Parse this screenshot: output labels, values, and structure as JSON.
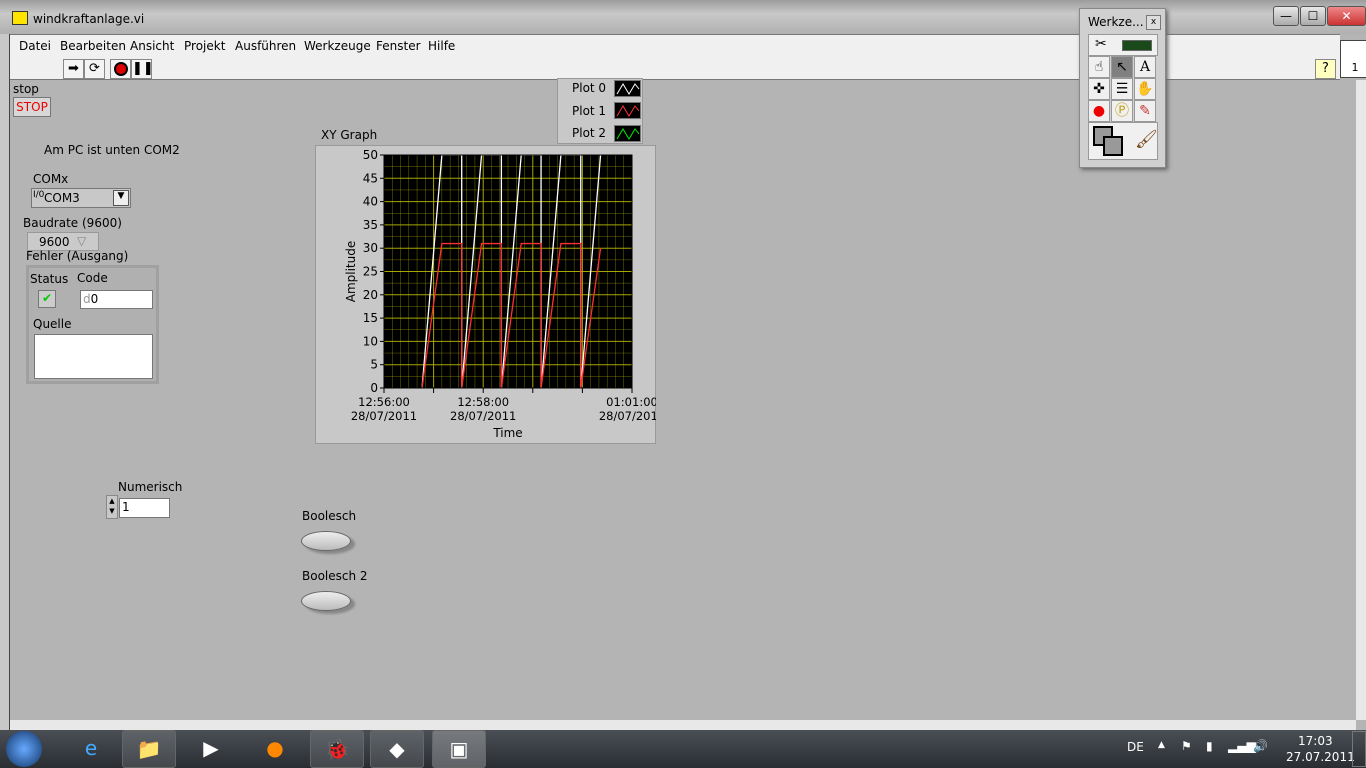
{
  "window": {
    "title": "windkraftanlage.vi",
    "controls": [
      "—",
      "☐",
      "✕"
    ]
  },
  "menu": [
    "Datei",
    "Bearbeiten",
    "Ansicht",
    "Projekt",
    "Ausführen",
    "Werkzeuge",
    "Fenster",
    "Hilfe"
  ],
  "toolbar": {
    "icons": [
      "run-arrow-icon",
      "run-continuously-icon",
      "abort-icon",
      "pause-icon"
    ],
    "help": "?",
    "connector_pane_number": "1"
  },
  "panel": {
    "stop_label": "stop",
    "stop_button": "STOP",
    "note": "Am PC ist unten COM2",
    "comx_label": "COMx",
    "comx_prefix": "I/0",
    "comx_value": "COM3",
    "baud_label": "Baudrate (9600)",
    "baud_value": "9600",
    "error_label": "Fehler (Ausgang)",
    "status_label": "Status",
    "code_label": "Code",
    "code_prefix": "d",
    "code_value": "0",
    "source_label": "Quelle",
    "source_value": "",
    "numeric_label": "Numerisch",
    "numeric_value": "1",
    "bool1_label": "Boolesch",
    "bool2_label": "Boolesch 2"
  },
  "palette": {
    "title": "Werkze...",
    "close": "x"
  },
  "chart_data": {
    "type": "line",
    "title": "XY Graph",
    "xlabel": "Time",
    "ylabel": "Amplitude",
    "xlim": [
      "12:56:00",
      "01:01:00"
    ],
    "ylim": [
      0,
      50
    ],
    "yticks": [
      0,
      5,
      10,
      15,
      20,
      25,
      30,
      35,
      40,
      45,
      50
    ],
    "xticks": [
      {
        "t": "12:56:00",
        "label1": "12:56:00",
        "label2": "28/07/2011"
      },
      {
        "t": "12:57:00",
        "label1": "",
        "label2": ""
      },
      {
        "t": "12:58:00",
        "label1": "12:58:00",
        "label2": "28/07/2011"
      },
      {
        "t": "12:59:00",
        "label1": "",
        "label2": ""
      },
      {
        "t": "01:00:00",
        "label1": "",
        "label2": ""
      },
      {
        "t": "01:01:00",
        "label1": "01:01:00",
        "label2": "28/07/2011"
      }
    ],
    "grid": true,
    "background": "#000000",
    "grid_color": "#b8b800",
    "legend_position": "top-right",
    "series": [
      {
        "name": "Plot 0",
        "color": "#ffffff",
        "points": [
          [
            "12:56:46",
            0
          ],
          [
            "12:57:10",
            50
          ],
          [
            "12:57:34",
            50
          ],
          [
            "12:57:34",
            0
          ],
          [
            "12:57:34",
            0
          ],
          [
            "12:57:58",
            50
          ],
          [
            "12:58:22",
            50
          ],
          [
            "12:58:22",
            0
          ],
          [
            "12:58:22",
            0
          ],
          [
            "12:58:46",
            50
          ],
          [
            "12:59:10",
            50
          ],
          [
            "12:59:10",
            0
          ],
          [
            "12:59:10",
            0
          ],
          [
            "12:59:34",
            50
          ],
          [
            "12:59:58",
            50
          ],
          [
            "12:59:58",
            0
          ],
          [
            "12:59:58",
            0
          ],
          [
            "01:00:22",
            50
          ]
        ]
      },
      {
        "name": "Plot 1",
        "color": "#ff3030",
        "points": [
          [
            "12:56:46",
            0
          ],
          [
            "12:57:10",
            31
          ],
          [
            "12:57:34",
            31
          ],
          [
            "12:57:34",
            0
          ],
          [
            "12:57:34",
            0
          ],
          [
            "12:57:58",
            31
          ],
          [
            "12:58:22",
            31
          ],
          [
            "12:58:22",
            0
          ],
          [
            "12:58:22",
            0
          ],
          [
            "12:58:46",
            31
          ],
          [
            "12:59:10",
            31
          ],
          [
            "12:59:10",
            0
          ],
          [
            "12:59:10",
            0
          ],
          [
            "12:59:34",
            31
          ],
          [
            "12:59:58",
            31
          ],
          [
            "12:59:58",
            0
          ],
          [
            "12:59:58",
            0
          ],
          [
            "01:00:22",
            30
          ]
        ]
      },
      {
        "name": "Plot 2",
        "color": "#00e000",
        "points": []
      }
    ]
  },
  "taskbar": {
    "apps": [
      "start-orb-icon",
      "internet-explorer-icon",
      "explorer-icon",
      "media-player-icon",
      "firefox-icon",
      "bug-app-icon",
      "notes-icon",
      "labview-icon"
    ],
    "language": "DE",
    "time": "17:03",
    "date": "27.07.2011"
  }
}
